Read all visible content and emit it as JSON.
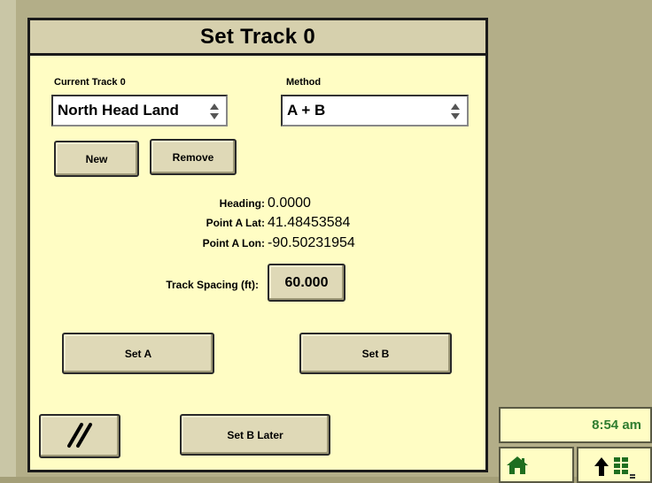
{
  "dialog": {
    "title": "Set Track 0"
  },
  "current_track": {
    "label": "Current Track 0",
    "value": "North Head Land"
  },
  "method": {
    "label": "Method",
    "value": "A + B"
  },
  "buttons": {
    "new": "New",
    "remove": "Remove",
    "set_a": "Set A",
    "set_b": "Set B",
    "set_b_later": "Set B Later"
  },
  "info": {
    "heading_label": "Heading:",
    "heading_value": "0.0000",
    "lat_label": "Point A Lat:",
    "lat_value": "41.48453584",
    "lon_label": "Point A Lon:",
    "lon_value": "-90.50231954",
    "spacing_label": "Track Spacing (ft):",
    "spacing_value": "60.000"
  },
  "status": {
    "time": "8:54 am"
  },
  "icons": {
    "shift": "shift-track-icon",
    "home": "home-icon",
    "menu": "menu-up-icon"
  },
  "colors": {
    "background": "#b3ae88",
    "dialog": "#fffdc4",
    "header": "#d6d0ad",
    "clock_text": "#2f7d2f",
    "home_icon": "#1f6e1f"
  }
}
